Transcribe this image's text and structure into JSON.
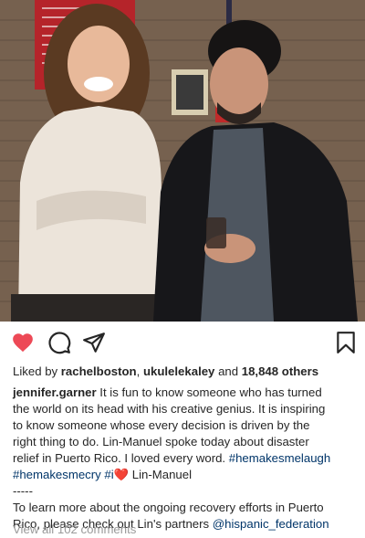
{
  "post": {
    "photo_icon": "photo-two-people",
    "actions": {
      "like_icon": "heart-filled-icon",
      "comment_icon": "comment-icon",
      "share_icon": "direct-share-icon",
      "save_icon": "bookmark-icon",
      "liked": true,
      "like_color": "#ed4956"
    },
    "likes": {
      "prefix": "Liked by",
      "user1": "rachelboston",
      "separator": ",",
      "user2": "ukulelekaley",
      "middle": "and",
      "others": "18,848 others"
    },
    "caption": {
      "username": "jennifer.garner",
      "line1": "It is fun to know someone who has turned",
      "line2": "the world on its head with his creative genius. It is inspiring",
      "line3": "to know someone whose every decision is driven by the",
      "line4": "right thing to do. Lin-Manuel spoke today about disaster",
      "line5_text": "relief in Puerto Rico. I loved every word.",
      "tag1": "#hemakesmelaugh",
      "tag2": "#hemakesmecry",
      "tag3": "#i",
      "heart": "❤️",
      "line6_text": "Lin-Manuel",
      "divider": "-----",
      "line8": "To learn more about the ongoing recovery efforts in Puerto",
      "line9_text": "Rico, please check out Lin's partners",
      "mention": "@hispanic_federation"
    },
    "view_comments": "View all 102 comments"
  }
}
